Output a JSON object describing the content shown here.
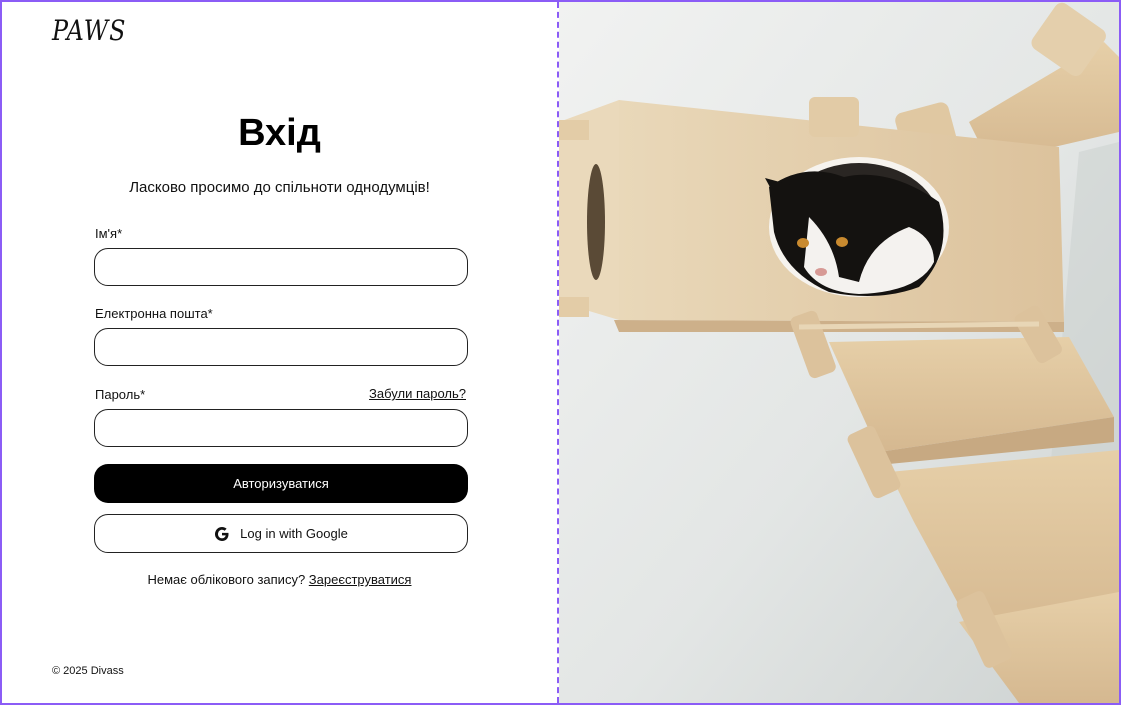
{
  "brand": {
    "logo": "PAWS"
  },
  "login": {
    "title": "Вхід",
    "subtitle": "Ласково просимо до спільноти однодумців!",
    "fields": {
      "name_label": "Ім'я*",
      "email_label": "Електронна пошта*",
      "password_label": "Пароль*",
      "forgot_password": "Забули пароль?",
      "name_value": "",
      "email_value": "",
      "password_value": ""
    },
    "submit_label": "Авторизуватися",
    "google_label": "Log in with Google",
    "signup_prompt": "Немає облікового запису?",
    "signup_link": "Зареєструватися"
  },
  "footer": {
    "copyright": "© 2025 Divass"
  },
  "hero": {
    "image_subject": "cat-in-wooden-wall-house-photo"
  },
  "colors": {
    "accent_border": "#8b5cf6",
    "primary_button": "#000000",
    "wood": "#e6d3b2"
  },
  "icons": {
    "google": "google-g-icon"
  }
}
